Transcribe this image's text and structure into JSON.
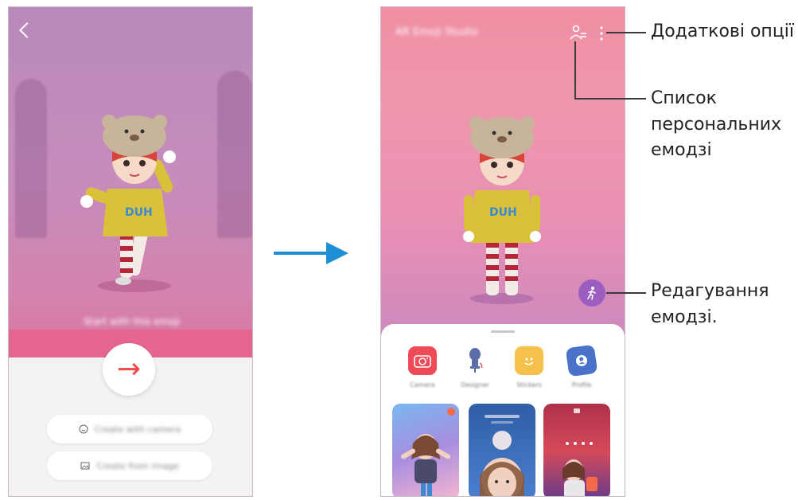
{
  "left_screen": {
    "hint_text": "Start with this emoji",
    "next_arrow": "→",
    "create_camera_label": "Create with camera",
    "create_image_label": "Create from image"
  },
  "right_screen": {
    "app_title": "AR Emoji Studio",
    "features": [
      {
        "label": "Camera",
        "icon": "camera-icon",
        "color": "#ef4a58"
      },
      {
        "label": "Designer",
        "icon": "designer-icon",
        "color": "#5b6ea8"
      },
      {
        "label": "Stickers",
        "icon": "sticker-icon",
        "color": "#f6c14a"
      },
      {
        "label": "Profile",
        "icon": "profile-icon",
        "color": "#4a72c9"
      }
    ]
  },
  "callouts": {
    "more_options": "Додаткові опції",
    "emoji_list_line1": "Список",
    "emoji_list_line2": "персональних",
    "emoji_list_line3": "емодзі",
    "edit_emoji_line1": "Редагування",
    "edit_emoji_line2": "емодзі."
  },
  "colors": {
    "accent_red": "#ef4a4a",
    "arrow_blue": "#1e8fd6",
    "edit_purple": "#9c5ec0"
  }
}
